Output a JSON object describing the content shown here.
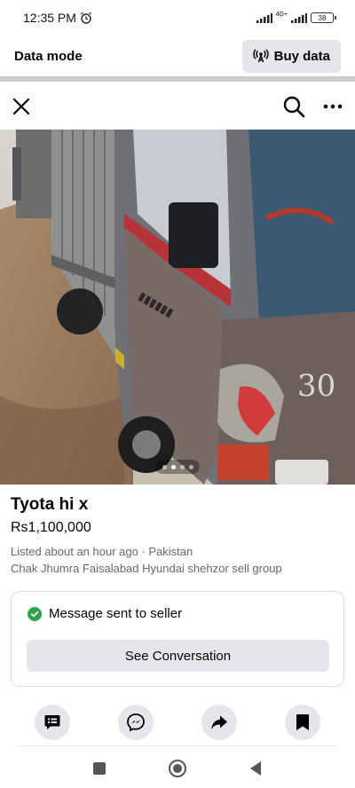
{
  "status_bar": {
    "time": "12:35 PM",
    "network": "4G+",
    "battery": "38",
    "alarm_icon": "alarm-clock-icon",
    "signal_icon": "signal-bars-icon"
  },
  "data_bar": {
    "label": "Data mode",
    "buy_button": "Buy data",
    "buy_icon": "antenna-icon"
  },
  "top_nav": {
    "close_icon": "close-icon",
    "search_icon": "search-icon",
    "more_icon": "more-horizontal-icon"
  },
  "photo": {
    "description_icon": "listing-photo",
    "page_count": 4,
    "active_page": 1
  },
  "listing": {
    "title": "Tyota hi x",
    "price": "Rs1,100,000",
    "meta": "Listed about an hour ago · Pakistan",
    "group": "Chak Jhumra Faisalabad Hyundai shehzor sell group"
  },
  "message_card": {
    "status": "Message sent to seller",
    "button": "See Conversation"
  },
  "actions": [
    {
      "name": "message-seller-icon"
    },
    {
      "name": "messenger-icon"
    },
    {
      "name": "share-icon"
    },
    {
      "name": "save-icon"
    }
  ],
  "colors": {
    "success": "#31a24c",
    "button_bg": "#e4e6eb",
    "secondary_text": "#65676b"
  }
}
